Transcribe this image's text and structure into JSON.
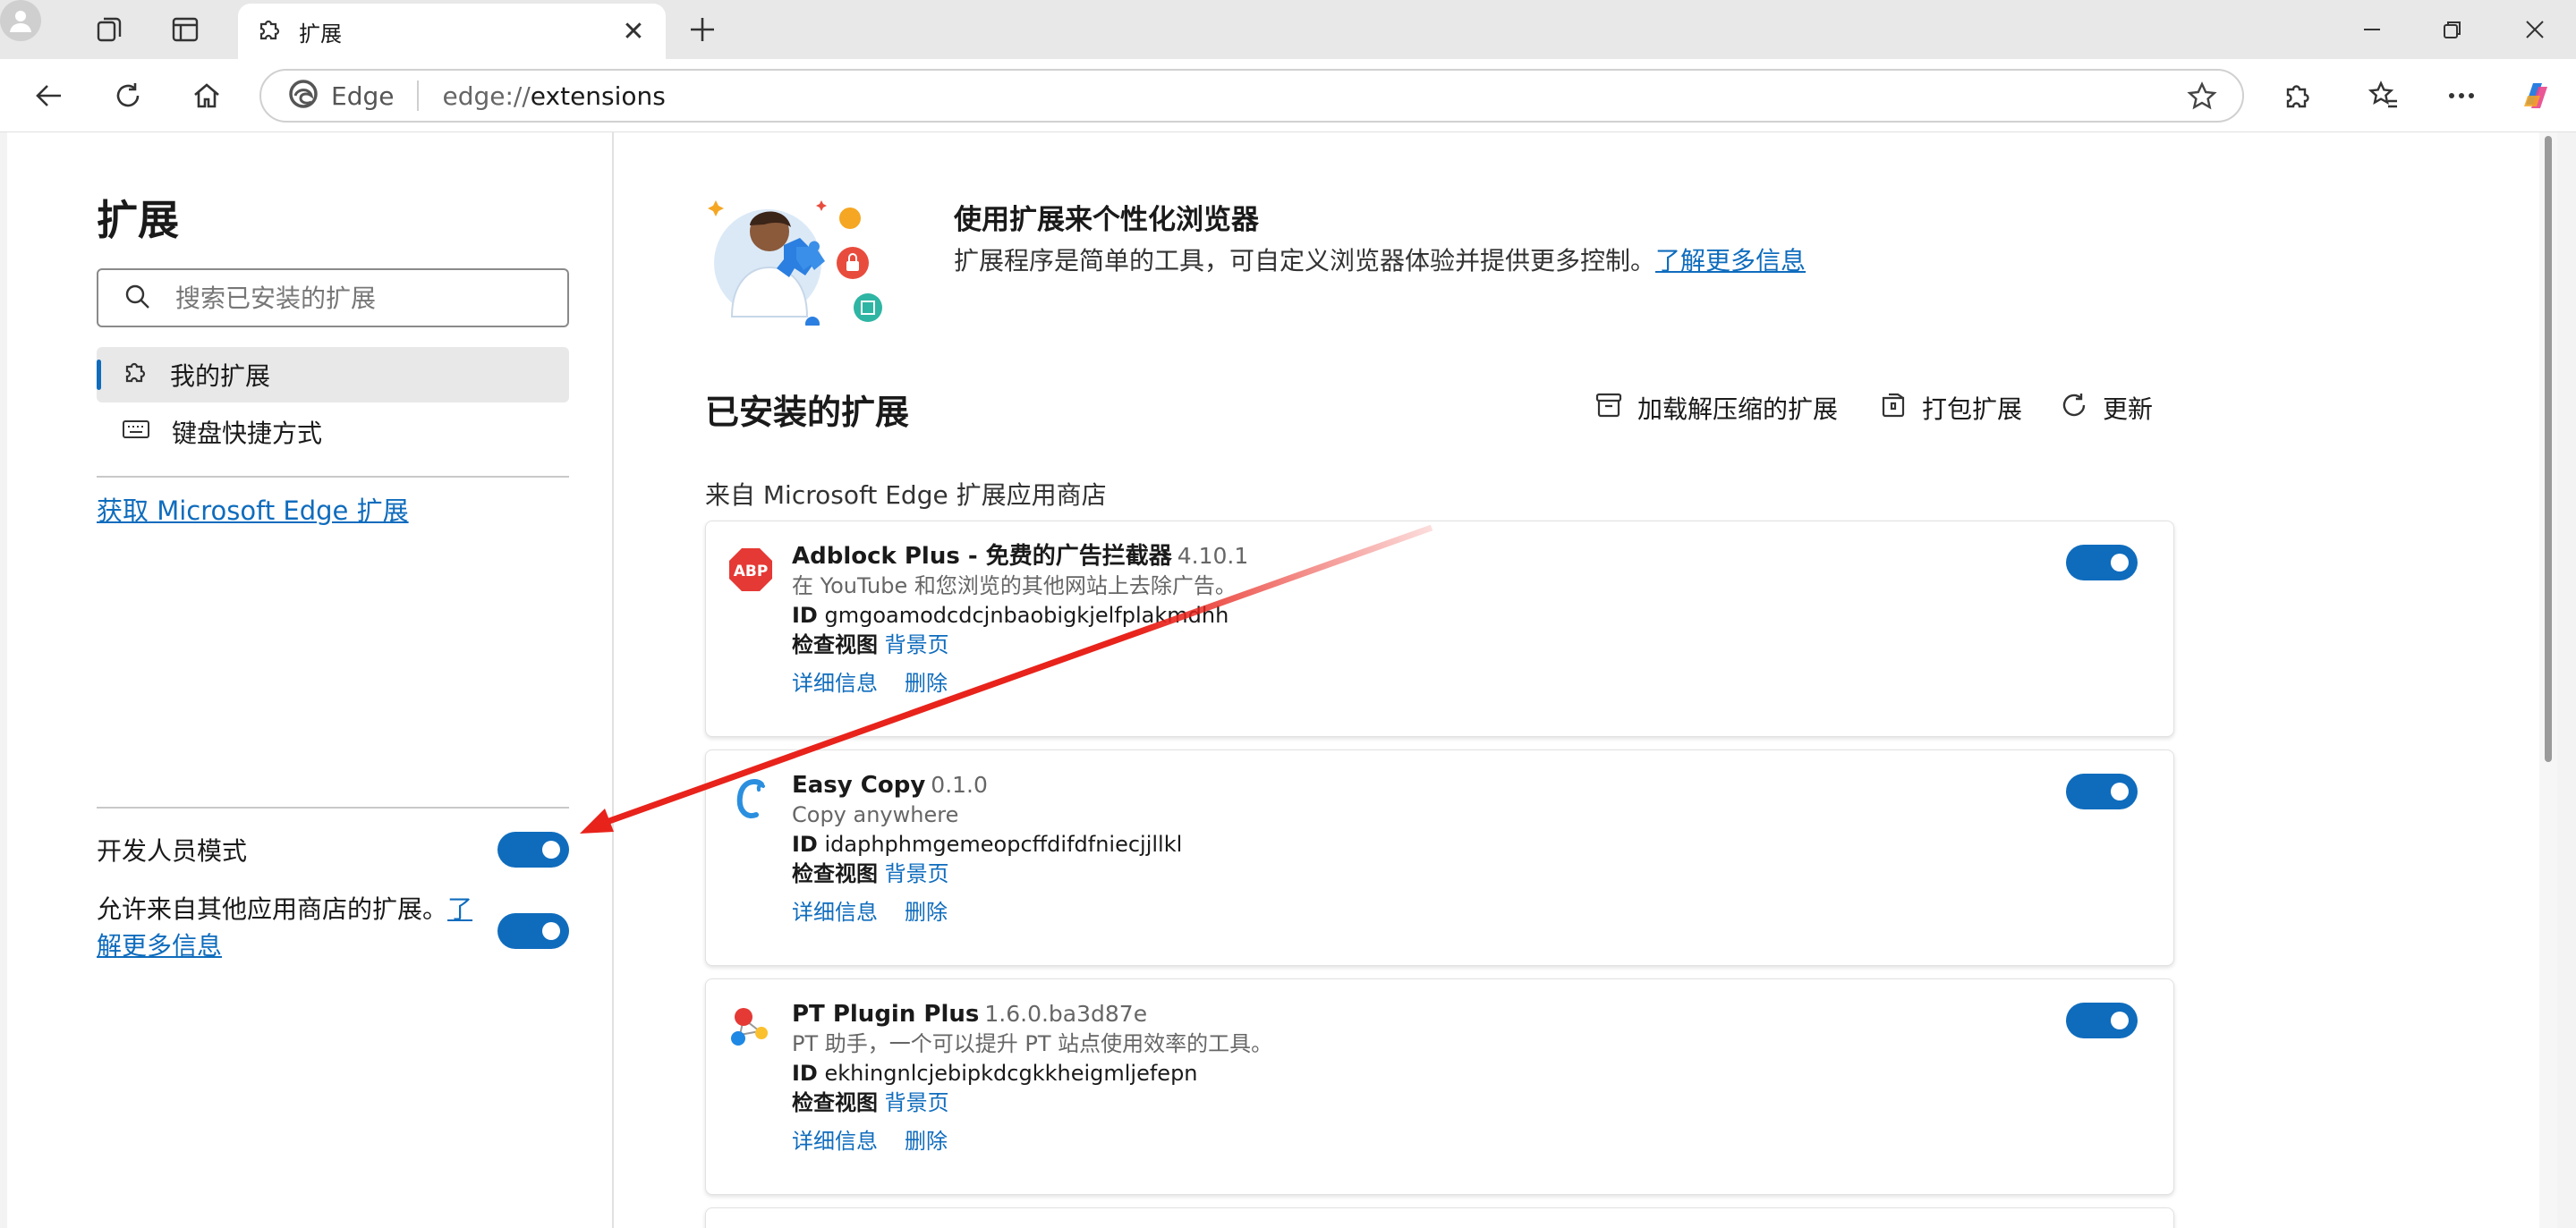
{
  "browser": {
    "tab_title": "扩展",
    "omnibox_brand": "Edge",
    "url_prefix": "edge://",
    "url_path": "extensions"
  },
  "sidebar": {
    "title": "扩展",
    "search_placeholder": "搜索已安装的扩展",
    "items": [
      {
        "label": "我的扩展",
        "active": true,
        "icon": "puzzle-icon"
      },
      {
        "label": "键盘快捷方式",
        "active": false,
        "icon": "keyboard-icon"
      }
    ],
    "get_extensions_link": "获取 Microsoft Edge 扩展",
    "developer_mode_label": "开发人员模式",
    "allow_other_stores_label": "允许来自其他应用商店的扩展。",
    "allow_other_stores_link": "了解更多信息"
  },
  "hero": {
    "title": "使用扩展来个性化浏览器",
    "description": "扩展程序是简单的工具，可自定义浏览器体验并提供更多控制。",
    "learn_more": "了解更多信息"
  },
  "installed": {
    "title": "已安装的扩展",
    "actions": [
      {
        "label": "加载解压缩的扩展",
        "icon": "load-unpacked-icon"
      },
      {
        "label": "打包扩展",
        "icon": "pack-icon"
      },
      {
        "label": "更新",
        "icon": "refresh-icon"
      }
    ],
    "store_label": "来自 Microsoft Edge 扩展应用商店",
    "id_label": "ID",
    "inspect_label": "检查视图",
    "background_page_link": "背景页",
    "details_link": "详细信息",
    "remove_link": "删除",
    "extensions": [
      {
        "name": "Adblock Plus - 免费的广告拦截器",
        "version": "4.10.1",
        "description": "在 YouTube 和您浏览的其他网站上去除广告。",
        "id": "gmgoamodcdcjnbaobigkjelfplakmdhh",
        "enabled": true
      },
      {
        "name": "Easy Copy",
        "version": "0.1.0",
        "description": "Copy anywhere",
        "id": "idaphphmgemeopcffdifdfniecjjllkl",
        "enabled": true
      },
      {
        "name": "PT Plugin Plus",
        "version": "1.6.0.ba3d87e",
        "description": "PT 助手，一个可以提升 PT 站点使用效率的工具。",
        "id": "ekhingnlcjebipkdcgkkheigmljefepn",
        "enabled": true
      }
    ]
  },
  "colors": {
    "accent": "#0f6cbd",
    "annotation_arrow": "#e8231b"
  }
}
